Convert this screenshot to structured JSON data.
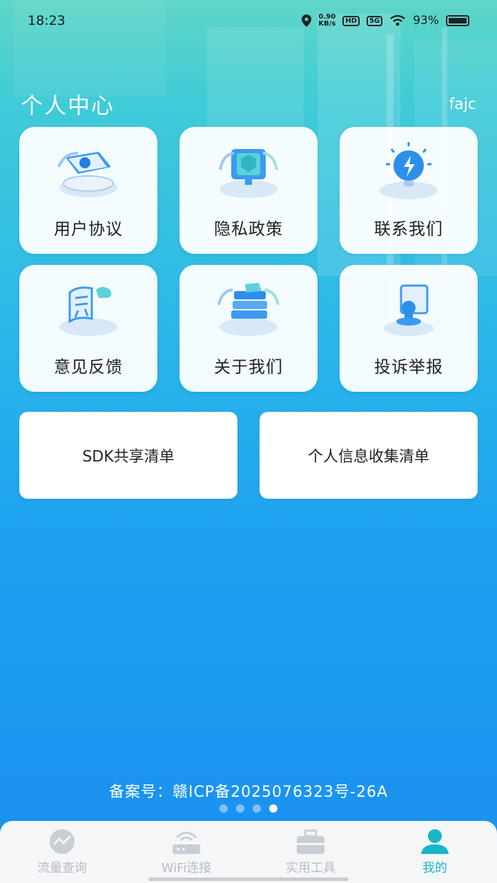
{
  "status_bar": {
    "time": "18:23",
    "net_speed_value": "0.90",
    "net_speed_unit": "KB/s",
    "hd_tag": "HD",
    "signal_tag": "5G",
    "battery": "93%"
  },
  "header": {
    "title": "个人中心",
    "user": "fajc"
  },
  "cards": [
    {
      "label": "用户协议",
      "icon": "document-icon"
    },
    {
      "label": "隐私政策",
      "icon": "shield-screen-icon"
    },
    {
      "label": "联系我们",
      "icon": "lightning-bulb-icon"
    },
    {
      "label": "意见反馈",
      "icon": "feedback-icon"
    },
    {
      "label": "关于我们",
      "icon": "books-icon"
    },
    {
      "label": "投诉举报",
      "icon": "stamp-icon"
    }
  ],
  "wide_buttons": [
    {
      "label": "SDK共享清单"
    },
    {
      "label": "个人信息收集清单"
    }
  ],
  "icp": "备案号：赣ICP备2025076323号-26A",
  "pager": {
    "count": 4,
    "active_index": 3
  },
  "tabs": [
    {
      "label": "流量查询",
      "icon": "chart-icon",
      "active": false
    },
    {
      "label": "WiFi连接",
      "icon": "router-icon",
      "active": false
    },
    {
      "label": "实用工具",
      "icon": "toolbox-icon",
      "active": false
    },
    {
      "label": "我的",
      "icon": "user-icon",
      "active": true
    }
  ],
  "colors": {
    "accent": "#19b5c8",
    "tab_inactive": "#b7bcc2",
    "icon_blue": "#3a9bf0"
  }
}
